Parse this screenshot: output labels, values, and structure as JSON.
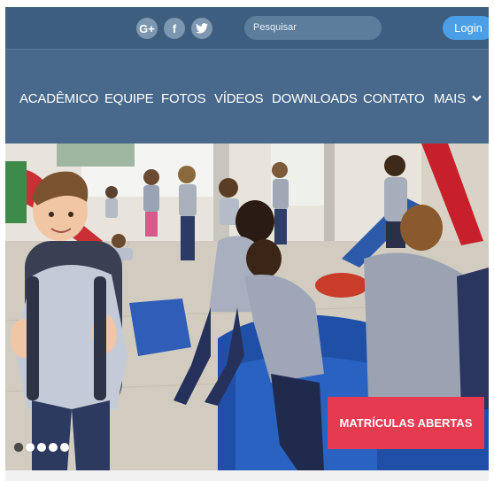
{
  "header": {
    "social": [
      {
        "name": "google-plus",
        "glyph": "G+"
      },
      {
        "name": "facebook",
        "glyph": "f"
      },
      {
        "name": "twitter",
        "glyph": "t"
      }
    ],
    "search_placeholder": "Pesquisar",
    "login_label": "Login"
  },
  "nav": {
    "items": [
      "ACADÊMICO",
      "EQUIPE",
      "FOTOS",
      "VÍDEOS",
      "DOWNLOADS",
      "CONTATO"
    ],
    "more_label": "MAIS"
  },
  "hero": {
    "cta_label": "MATRÍCULAS ABERTAS",
    "slides_count": 5,
    "active_slide": 1
  },
  "colors": {
    "topbar": "#3e5e80",
    "navbar": "#48698c",
    "login": "#4a9fe6",
    "cta": "#e53a4f"
  }
}
